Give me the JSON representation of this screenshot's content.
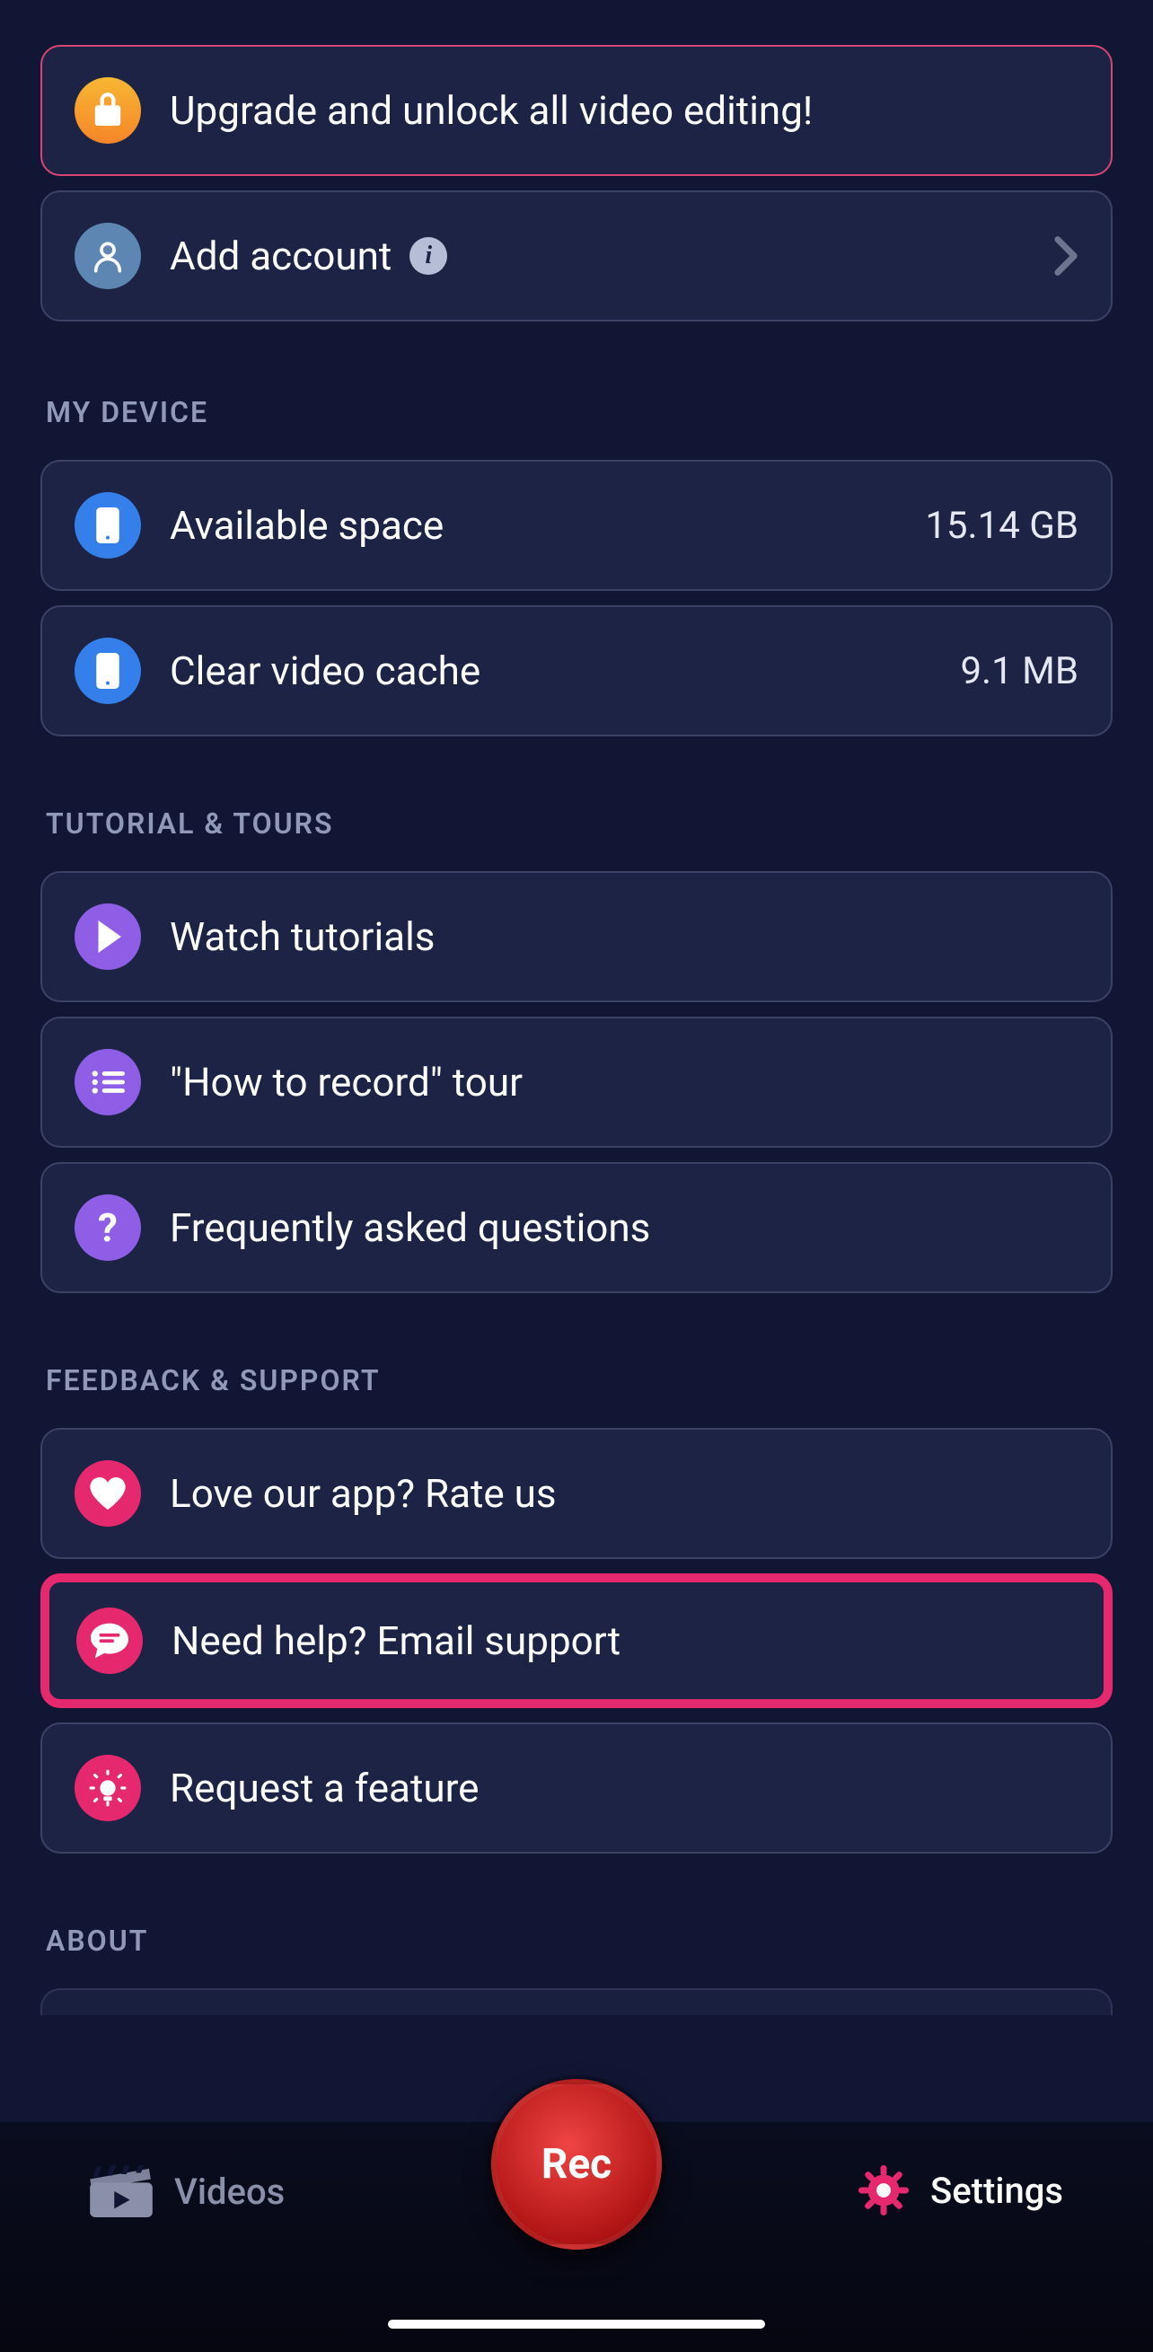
{
  "upgrade": {
    "label": "Upgrade and unlock all video editing!"
  },
  "account": {
    "label": "Add account"
  },
  "sections": {
    "device": {
      "title": "MY DEVICE",
      "available_space": {
        "label": "Available space",
        "value": "15.14 GB"
      },
      "clear_cache": {
        "label": "Clear video cache",
        "value": "9.1 MB"
      }
    },
    "tutorials": {
      "title": "TUTORIAL & TOURS",
      "watch": {
        "label": "Watch tutorials"
      },
      "tour": {
        "label": "\"How to record\" tour"
      },
      "faq": {
        "label": "Frequently asked questions"
      }
    },
    "feedback": {
      "title": "FEEDBACK & SUPPORT",
      "rate": {
        "label": "Love our app? Rate us"
      },
      "email": {
        "label": "Need help? Email support"
      },
      "feature": {
        "label": "Request a feature"
      }
    },
    "about": {
      "title": "ABOUT"
    }
  },
  "nav": {
    "videos": "Videos",
    "settings": "Settings",
    "rec": "Rec"
  }
}
